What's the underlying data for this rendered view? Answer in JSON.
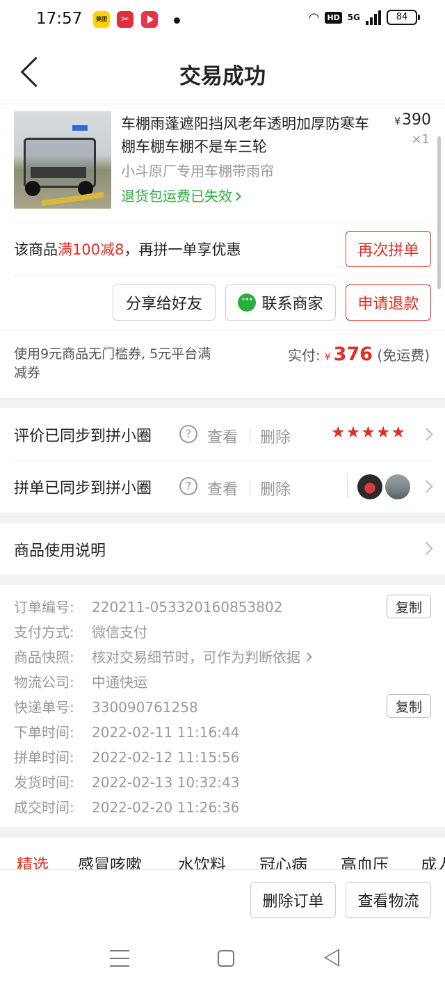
{
  "status_bar": {
    "time": "17:57",
    "app_meituan_label": "美团",
    "battery": "84",
    "hd": "HD",
    "network": "5G"
  },
  "header": {
    "title": "交易成功"
  },
  "product": {
    "title": "车棚雨蓬遮阳挡风老年透明加厚防寒车棚车棚车棚不是车三轮",
    "price_symbol": "¥",
    "price": "390",
    "quantity": "×1",
    "spec": "小斗原厂专用车棚带雨帘",
    "refund_note": "退货包运费已失效"
  },
  "promo": {
    "prefix": "该商品",
    "highlight": "满100减8",
    "suffix": "，再拼一单享优惠",
    "reorder_button": "再次拼单"
  },
  "actions": {
    "share": "分享给好友",
    "contact": "联系商家",
    "refund": "申请退款"
  },
  "payment": {
    "coupon_text": "使用9元商品无门槛券, 5元平台满减券",
    "paid_label": "实付:",
    "currency": "¥",
    "amount": "376",
    "shipping_note": "(免运费)"
  },
  "sync": {
    "review_label": "评价已同步到拼小圈",
    "group_label": "拼单已同步到拼小圈",
    "help": "?",
    "view": "查看",
    "delete": "删除",
    "stars": "★★★★★",
    "star_rating": 5
  },
  "usage": {
    "label": "商品使用说明"
  },
  "order": {
    "copy_label": "复制",
    "rows": [
      {
        "key": "订单编号:",
        "value": "220211-053320160853802"
      },
      {
        "key": "支付方式:",
        "value": "微信支付"
      },
      {
        "key": "商品快照:",
        "value": "核对交易细节时，可作为判断依据"
      },
      {
        "key": "物流公司:",
        "value": "中通快运"
      },
      {
        "key": "快递单号:",
        "value": "330090761258"
      },
      {
        "key": "下单时间:",
        "value": "2022-02-11 11:16:44"
      },
      {
        "key": "拼单时间:",
        "value": "2022-02-12 11:15:56"
      },
      {
        "key": "发货时间:",
        "value": "2022-02-13 10:32:43"
      },
      {
        "key": "成交时间:",
        "value": "2022-02-20 11:26:36"
      }
    ]
  },
  "tabs": [
    "精选",
    "感冒咳嗽",
    "水饮料",
    "冠心病",
    "高血压",
    "成人"
  ],
  "bottom_actions": {
    "delete_order": "删除订单",
    "view_logistics": "查看物流"
  },
  "colors": {
    "accent_red": "#e02e24",
    "green": "#2aae3c"
  }
}
